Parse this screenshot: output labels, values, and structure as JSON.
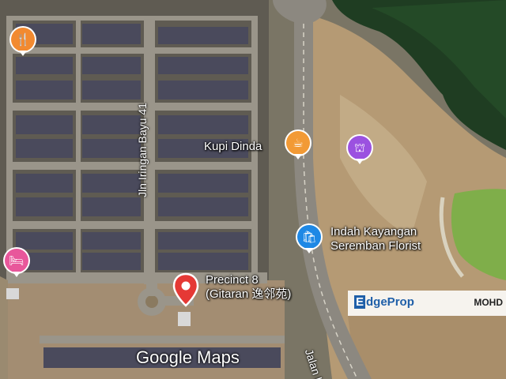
{
  "map": {
    "attribution": "Google Maps",
    "places": [
      {
        "name": "Kupi Dinda",
        "icon": "cafe-icon",
        "color": "#f29a35"
      },
      {
        "name": "Indah Kayangan Seremban Florist",
        "icon": "shopping-bag-icon",
        "color": "#1e88e5"
      },
      {
        "name": "Precinct 8 (Gitaran 逸邻苑)",
        "icon": "location-pin-icon",
        "color": "#e53935"
      }
    ],
    "roads": [
      {
        "name": "Jln Iringan Bayu 41"
      },
      {
        "name": "Jalan I"
      }
    ],
    "labels": {
      "kupi": "Kupi Dinda",
      "florist_line1": "Indah Kayangan",
      "florist_line2": "Seremban Florist",
      "precinct_line1": "Precinct 8",
      "precinct_line2": "(Gitaran 逸邻苑)"
    },
    "poi_colors": {
      "restaurant": "#f28a30",
      "cafe": "#f29a35",
      "landmark": "#9b51e0",
      "shopping": "#1e88e5",
      "hotel": "#e8579b",
      "pin": "#e53935"
    }
  },
  "watermark": {
    "logo_e": "E",
    "logo_rest": "dgeProp",
    "user": "MOHD"
  }
}
